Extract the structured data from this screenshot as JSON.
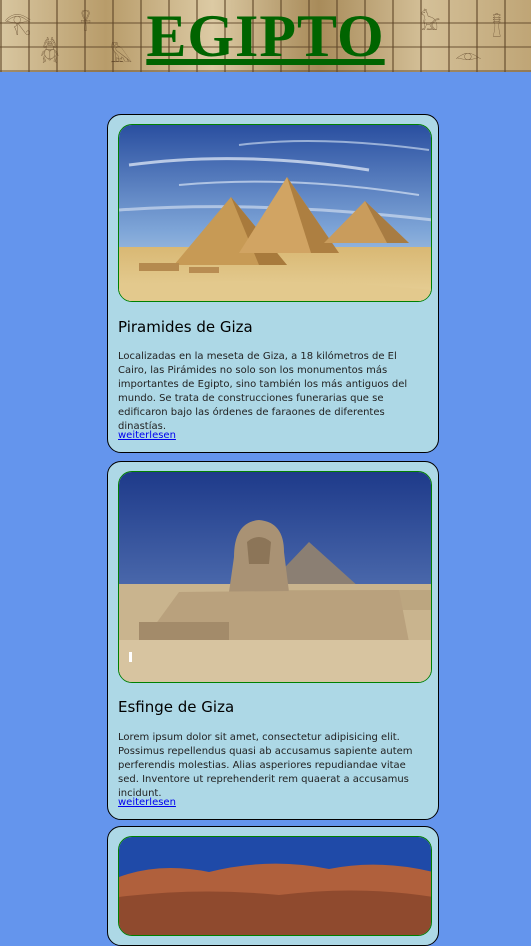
{
  "header": {
    "title": "EGIPTO"
  },
  "cards": [
    {
      "image_alt": "Pyramids of Giza in the desert",
      "title": "Piramides de Giza",
      "text": "Localizadas en la meseta de Giza, a 18 kilómetros de El Cairo, las Pirámides no solo son los monumentos más importantes de Egipto, sino también los más antiguos del mundo. Se trata de construcciones funerarias que se edificaron bajo las órdenes de faraones de diferentes dinastías.",
      "link": "weiterlesen"
    },
    {
      "image_alt": "Great Sphinx of Giza",
      "title": "Esfinge de Giza",
      "text": "Lorem ipsum dolor sit amet, consectetur adipisicing elit. Possimus repellendus quasi ab accusamus sapiente autem perferendis molestias. Alias asperiores repudiandae vitae sed. Inventore ut reprehenderit rem quaerat a accusamus incidunt.",
      "link": "weiterlesen"
    },
    {
      "image_alt": "Desert cliffs under blue sky"
    }
  ],
  "colors": {
    "background": "#6495ed",
    "card": "#add8e6",
    "title": "#006400",
    "image_border": "#008000",
    "link": "#0000ee"
  }
}
